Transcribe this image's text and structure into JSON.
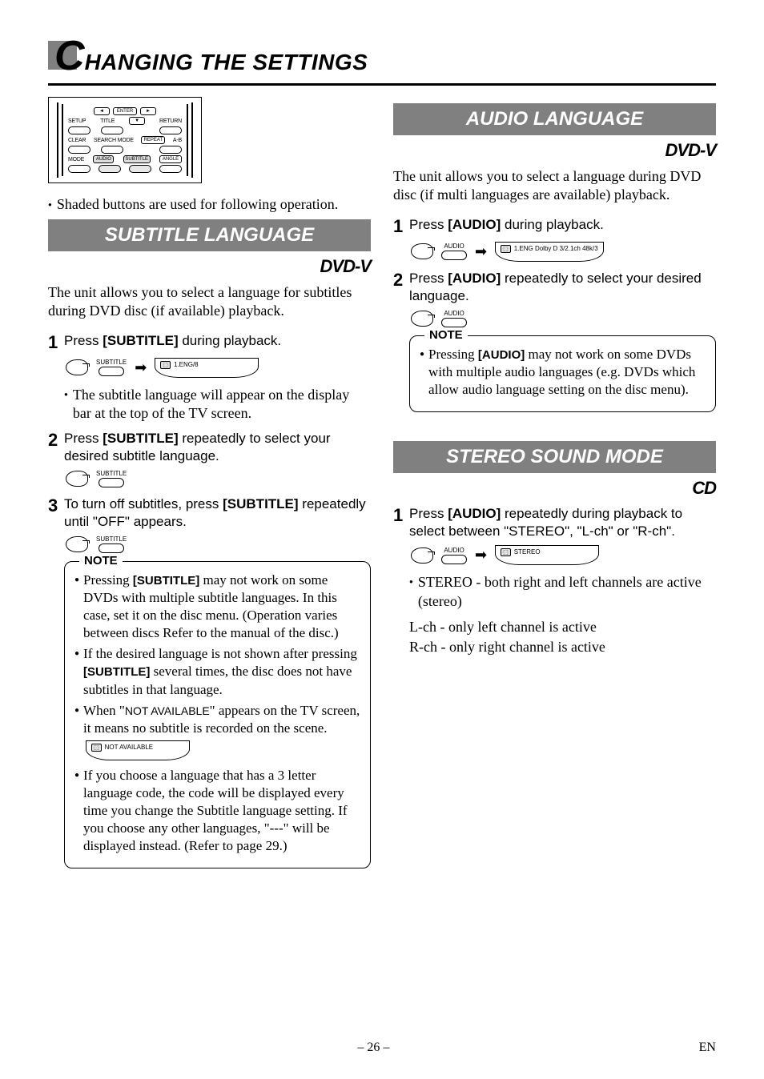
{
  "header": {
    "first_letter": "C",
    "rest": "HANGING THE SETTINGS"
  },
  "remote": {
    "top_row": [
      "◄",
      "ENTER",
      "►"
    ],
    "row2": [
      "SETUP",
      "TITLE",
      "▼",
      "RETURN"
    ],
    "row3": [
      "CLEAR",
      "SEARCH MODE",
      "REPEAT",
      "A-B"
    ],
    "row4": [
      "MODE",
      "AUDIO",
      "SUBTITLE",
      "ANGLE"
    ]
  },
  "shaded_note": "Shaded buttons are used for following operation.",
  "subtitle_section": {
    "title": "SUBTITLE LANGUAGE",
    "badge": "DVD-V",
    "intro": "The unit allows you to select a language for subtitles during DVD disc (if available) playback.",
    "step1": {
      "num": "1",
      "text_a": "Press ",
      "btn": "[SUBTITLE]",
      "text_b": " during playback."
    },
    "osd1": "1.ENG/8",
    "btn_label": "SUBTITLE",
    "sub_bullet1": "The subtitle language will appear on the display bar at the top of the TV screen.",
    "step2": {
      "num": "2",
      "text_a": "Press ",
      "btn": "[SUBTITLE]",
      "text_b": " repeatedly to select your desired subtitle language."
    },
    "step3": {
      "num": "3",
      "text_a": "To turn off subtitles, press ",
      "btn": "[SUBTITLE]",
      "text_b": " repeatedly until \"OFF\" appears."
    },
    "note_title": "NOTE",
    "note1_a": "Pressing ",
    "note1_btn": "[SUBTITLE]",
    "note1_b": " may not work on some DVDs with multiple subtitle languages. In this case, set it on the disc menu. (Operation varies between discs Refer to the manual of the disc.)",
    "note2_a": "If the desired language is not shown after pressing ",
    "note2_btn": "[SUBTITLE]",
    "note2_b": " several times, the disc does not have subtitles in that language.",
    "note3_a": "When \"",
    "note3_mid": "NOT AVAILABLE",
    "note3_b": "\" appears on the TV screen, it means no subtitle is recorded on the scene.",
    "osd_na": "NOT AVAILABLE",
    "note4": "If you choose a language that has a 3 letter language code, the code will be displayed every time you change the Subtitle language setting. If you choose any other languages, \"---\" will be displayed instead. (Refer to page 29.)"
  },
  "audio_section": {
    "title": "AUDIO LANGUAGE",
    "badge": "DVD-V",
    "intro": "The unit allows you to select a language during DVD disc (if multi languages are available) playback.",
    "step1": {
      "num": "1",
      "text_a": "Press ",
      "btn": "[AUDIO]",
      "text_b": " during playback."
    },
    "btn_label": "AUDIO",
    "osd1": "1.ENG  Dolby D  3/2.1ch  48k/3",
    "step2": {
      "num": "2",
      "text_a": "Press ",
      "btn": "[AUDIO]",
      "text_b": " repeatedly to select your desired language."
    },
    "note_title": "NOTE",
    "note1_a": "Pressing ",
    "note1_btn": "[AUDIO]",
    "note1_b": " may not work on some DVDs with multiple audio languages (e.g. DVDs which allow audio language setting on the disc menu)."
  },
  "stereo_section": {
    "title": "STEREO SOUND MODE",
    "badge": "CD",
    "step1": {
      "num": "1",
      "text_a": "Press ",
      "btn": "[AUDIO]",
      "text_b": " repeatedly during playback to select between \"STEREO\", \"L-ch\" or \"R-ch\"."
    },
    "btn_label": "AUDIO",
    "osd1": "STEREO",
    "desc_bullet": "STEREO - both right and left channels are active (stereo)",
    "desc_l": "L-ch - only left channel is active",
    "desc_r": "R-ch - only right channel is active"
  },
  "footer": {
    "page": "– 26 –",
    "lang": "EN"
  }
}
